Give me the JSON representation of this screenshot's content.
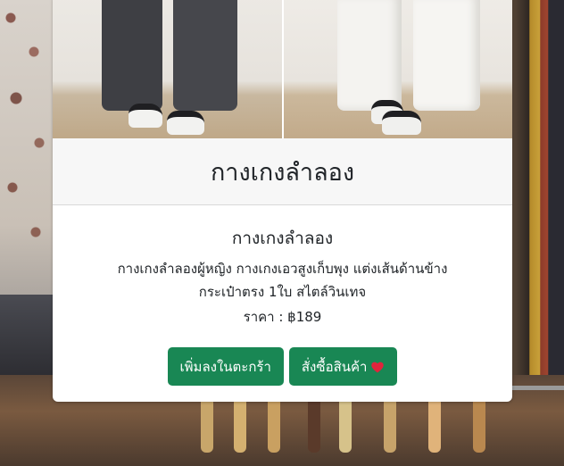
{
  "product": {
    "header_title": "กางเกงลำลอง",
    "name": "กางเกงลำลอง",
    "description_line1": "กางเกงลำลองผู้หญิง กางเกงเอวสูงเก็บพุง แต่งเส้นด้านข้าง",
    "description_line2": "กระเป๋าตรง 1ใบ สไตล์วินเทจ",
    "price_text": "ราคา : ฿189"
  },
  "actions": {
    "add_to_cart_label": "เพิ่มลงในตะกร้า",
    "order_label": "สั่งซื้อสินค้า",
    "order_icon": "heart-icon"
  },
  "colors": {
    "button_green": "#198754",
    "heart_red": "#e0243c"
  }
}
